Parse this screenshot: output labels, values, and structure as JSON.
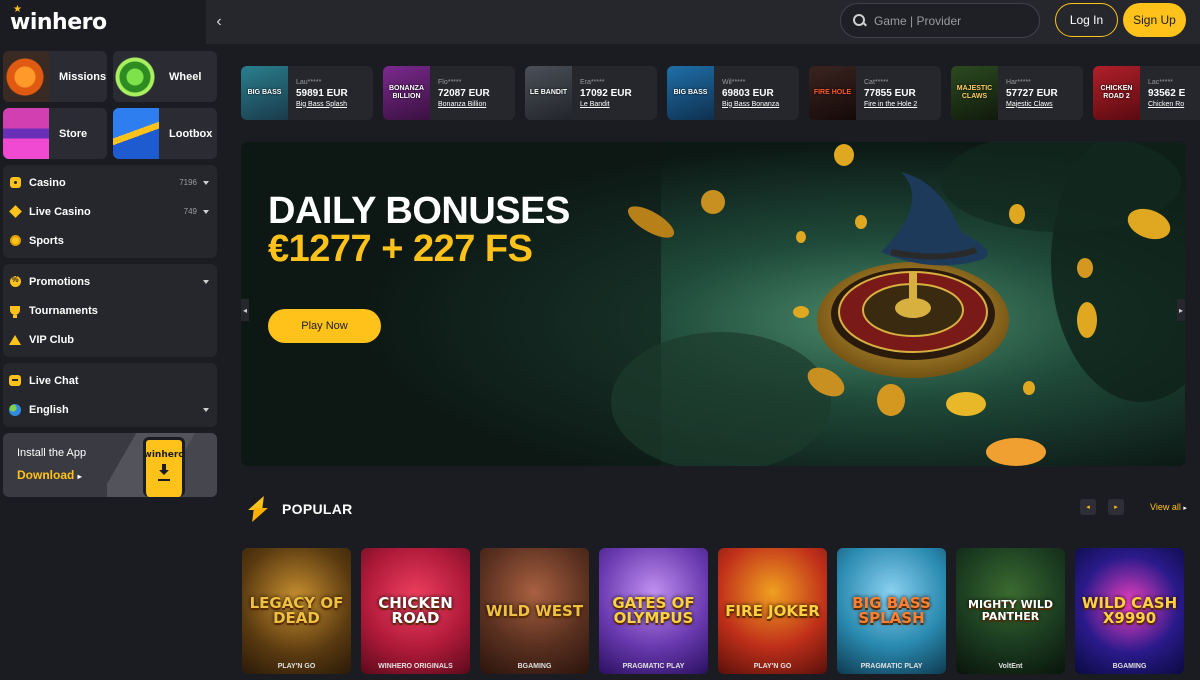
{
  "brand": {
    "logo_text": "winhero"
  },
  "header": {
    "search_placeholder": "Game | Provider",
    "login_label": "Log In",
    "signup_label": "Sign Up"
  },
  "sidebar": {
    "tiles": [
      {
        "label": "Missions"
      },
      {
        "label": "Wheel"
      },
      {
        "label": "Store"
      },
      {
        "label": "Lootbox"
      }
    ],
    "group1": [
      {
        "label": "Casino",
        "count": "7196"
      },
      {
        "label": "Live Casino",
        "count": "749"
      },
      {
        "label": "Sports"
      }
    ],
    "group2": [
      {
        "label": "Promotions"
      },
      {
        "label": "Tournaments"
      },
      {
        "label": "VIP Club"
      }
    ],
    "group3": [
      {
        "label": "Live Chat"
      },
      {
        "label": "English"
      }
    ],
    "app_promo": {
      "title": "Install the App",
      "cta": "Download",
      "phone_brand": "winhero"
    }
  },
  "winners": [
    {
      "user": "Lau*****",
      "amount": "59891 EUR",
      "game": "Big Bass Splash",
      "thumb_text": "BIG BASS",
      "color": "#2a7f8e"
    },
    {
      "user": "Flo*****",
      "amount": "72087 EUR",
      "game": "Bonanza Billion",
      "thumb_text": "BONANZA BILLION",
      "color": "#7a2a8e"
    },
    {
      "user": "Era*****",
      "amount": "17092 EUR",
      "game": "Le Bandit",
      "thumb_text": "LE BANDIT",
      "color": "#4a4f58"
    },
    {
      "user": "Wil*****",
      "amount": "69803 EUR",
      "game": "Big Bass Bonanza",
      "thumb_text": "BIG BASS",
      "color": "#1f6fa8"
    },
    {
      "user": "Cat*****",
      "amount": "77855 EUR",
      "game": "Fire in the Hole 2",
      "thumb_text": "FIRE HOLE",
      "color": "#3a2420"
    },
    {
      "user": "Har*****",
      "amount": "57727 EUR",
      "game": "Majestic Claws",
      "thumb_text": "MAJESTIC CLAWS",
      "color": "#2c4a20"
    },
    {
      "user": "Lac*****",
      "amount": "93562 E",
      "game": "Chicken Ro",
      "thumb_text": "CHICKEN ROAD 2",
      "color": "#b0202a"
    }
  ],
  "banner": {
    "title": "DAILY BONUSES",
    "amount": "€1277 + 227 FS",
    "cta": "Play Now"
  },
  "popular": {
    "title": "POPULAR",
    "view_all": "View all",
    "games": [
      {
        "title": "LEGACY OF DEAD",
        "provider": "PLAY'N GO",
        "color": "#5a3a10"
      },
      {
        "title": "CHICKEN ROAD",
        "provider": "WINHERO ORIGINALS",
        "color": "#b01a3a"
      },
      {
        "title": "WILD WEST",
        "provider": "BGAMING",
        "color": "#5a3020"
      },
      {
        "title": "GATES OF OLYMPUS",
        "provider": "PRAGMATIC PLAY",
        "color": "#6a3ab0"
      },
      {
        "title": "FIRE JOKER",
        "provider": "PLAY'N GO",
        "color": "#c0301a"
      },
      {
        "title": "BIG BASS SPLASH",
        "provider": "PRAGMATIC PLAY",
        "color": "#2a8ab0"
      },
      {
        "title": "MIGHTY WILD PANTHER",
        "provider": "VoltEnt",
        "color": "#1a3a20"
      },
      {
        "title": "WILD CASH X9990",
        "provider": "BGAMING",
        "color": "#2a1a8a"
      }
    ]
  },
  "colors": {
    "accent": "#ffc21a",
    "background": "#1b1c21",
    "panel": "#26272d"
  }
}
